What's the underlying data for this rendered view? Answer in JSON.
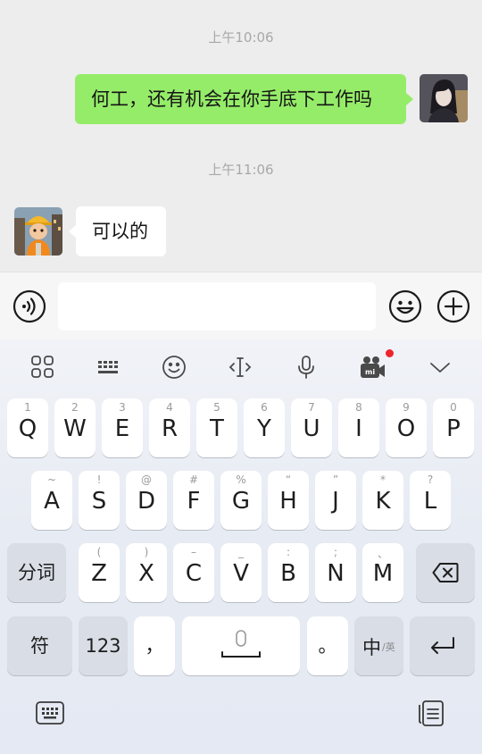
{
  "chat": {
    "time1": "上午10:06",
    "msg1": "何工，还有机会在你手底下工作吗",
    "time2": "上午11:06",
    "msg2": "可以的"
  },
  "input": {
    "value": "",
    "placeholder": ""
  },
  "keyboard": {
    "row1": [
      {
        "sub": "1",
        "main": "Q"
      },
      {
        "sub": "2",
        "main": "W"
      },
      {
        "sub": "3",
        "main": "E"
      },
      {
        "sub": "4",
        "main": "R"
      },
      {
        "sub": "5",
        "main": "T"
      },
      {
        "sub": "6",
        "main": "Y"
      },
      {
        "sub": "7",
        "main": "U"
      },
      {
        "sub": "8",
        "main": "I"
      },
      {
        "sub": "9",
        "main": "O"
      },
      {
        "sub": "0",
        "main": "P"
      }
    ],
    "row2": [
      {
        "sub": "~",
        "main": "A"
      },
      {
        "sub": "!",
        "main": "S"
      },
      {
        "sub": "@",
        "main": "D"
      },
      {
        "sub": "#",
        "main": "F"
      },
      {
        "sub": "%",
        "main": "G"
      },
      {
        "sub": "“",
        "main": "H"
      },
      {
        "sub": "”",
        "main": "J"
      },
      {
        "sub": "*",
        "main": "K"
      },
      {
        "sub": "?",
        "main": "L"
      }
    ],
    "row3": [
      {
        "sub": "(",
        "main": "Z"
      },
      {
        "sub": ")",
        "main": "X"
      },
      {
        "sub": "–",
        "main": "C"
      },
      {
        "sub": "_",
        "main": "V"
      },
      {
        "sub": ":",
        "main": "B"
      },
      {
        "sub": ";",
        "main": "N"
      },
      {
        "sub": "、",
        "main": "M"
      }
    ],
    "segment_label": "分词",
    "symbol_label": "符",
    "number_label": "123",
    "comma_label": "，",
    "period_label": "。",
    "lang_main": "中",
    "lang_sub": "/英"
  },
  "colors": {
    "my_bubble": "#95ec69",
    "other_bubble": "#ffffff",
    "notification_dot": "#f1232a"
  },
  "icons": {
    "toolbar": [
      "apps-grid-icon",
      "keyboard-layout-icon",
      "emoji-icon",
      "cursor-icon",
      "microphone-icon",
      "video-camera-icon",
      "collapse-chevron-icon"
    ],
    "input_bar": [
      "voice-icon",
      "emoji-icon",
      "plus-icon"
    ],
    "bottom": [
      "keyboard-switch-icon",
      "clipboard-icon"
    ]
  }
}
